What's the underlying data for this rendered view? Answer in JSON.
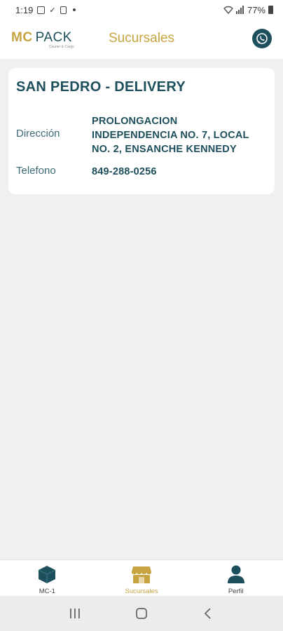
{
  "status_bar": {
    "time": "1:19",
    "battery": "77%"
  },
  "app_bar": {
    "logo_mc": "MC",
    "logo_pack": "PACK",
    "logo_tagline": "Courier & Cargo",
    "title": "Sucursales"
  },
  "branch": {
    "name": "SAN PEDRO - DELIVERY",
    "address_label": "Dirección",
    "address_value": "PROLONGACION INDEPENDENCIA NO. 7, LOCAL NO. 2, ENSANCHE KENNEDY",
    "phone_label": "Telefono",
    "phone_value": "849-288-0256"
  },
  "bottom_nav": {
    "items": [
      {
        "label": "MC-1",
        "icon": "box-icon"
      },
      {
        "label": "Sucursales",
        "icon": "store-icon",
        "active": true
      },
      {
        "label": "Perfil",
        "icon": "person-icon"
      }
    ]
  },
  "colors": {
    "primary": "#1d4f5c",
    "accent": "#c7a441",
    "background": "#f0f0f0"
  }
}
